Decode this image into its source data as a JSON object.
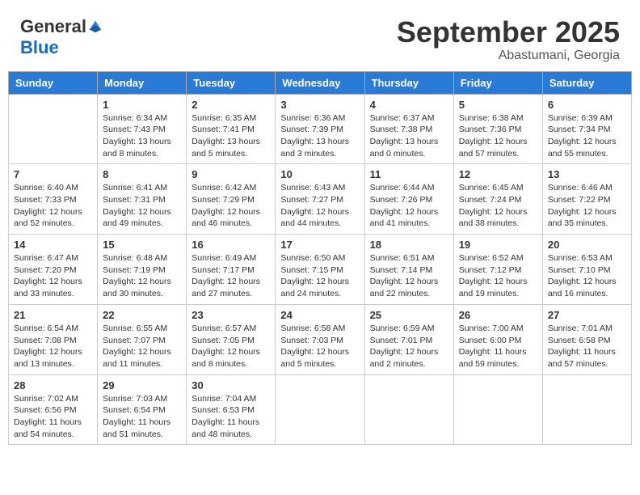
{
  "header": {
    "logo_general": "General",
    "logo_blue": "Blue",
    "month_title": "September 2025",
    "location": "Abastumani, Georgia"
  },
  "weekdays": [
    "Sunday",
    "Monday",
    "Tuesday",
    "Wednesday",
    "Thursday",
    "Friday",
    "Saturday"
  ],
  "weeks": [
    [
      {
        "day": "",
        "sunrise": "",
        "sunset": "",
        "daylight": ""
      },
      {
        "day": "1",
        "sunrise": "Sunrise: 6:34 AM",
        "sunset": "Sunset: 7:43 PM",
        "daylight": "Daylight: 13 hours and 8 minutes."
      },
      {
        "day": "2",
        "sunrise": "Sunrise: 6:35 AM",
        "sunset": "Sunset: 7:41 PM",
        "daylight": "Daylight: 13 hours and 5 minutes."
      },
      {
        "day": "3",
        "sunrise": "Sunrise: 6:36 AM",
        "sunset": "Sunset: 7:39 PM",
        "daylight": "Daylight: 13 hours and 3 minutes."
      },
      {
        "day": "4",
        "sunrise": "Sunrise: 6:37 AM",
        "sunset": "Sunset: 7:38 PM",
        "daylight": "Daylight: 13 hours and 0 minutes."
      },
      {
        "day": "5",
        "sunrise": "Sunrise: 6:38 AM",
        "sunset": "Sunset: 7:36 PM",
        "daylight": "Daylight: 12 hours and 57 minutes."
      },
      {
        "day": "6",
        "sunrise": "Sunrise: 6:39 AM",
        "sunset": "Sunset: 7:34 PM",
        "daylight": "Daylight: 12 hours and 55 minutes."
      }
    ],
    [
      {
        "day": "7",
        "sunrise": "Sunrise: 6:40 AM",
        "sunset": "Sunset: 7:33 PM",
        "daylight": "Daylight: 12 hours and 52 minutes."
      },
      {
        "day": "8",
        "sunrise": "Sunrise: 6:41 AM",
        "sunset": "Sunset: 7:31 PM",
        "daylight": "Daylight: 12 hours and 49 minutes."
      },
      {
        "day": "9",
        "sunrise": "Sunrise: 6:42 AM",
        "sunset": "Sunset: 7:29 PM",
        "daylight": "Daylight: 12 hours and 46 minutes."
      },
      {
        "day": "10",
        "sunrise": "Sunrise: 6:43 AM",
        "sunset": "Sunset: 7:27 PM",
        "daylight": "Daylight: 12 hours and 44 minutes."
      },
      {
        "day": "11",
        "sunrise": "Sunrise: 6:44 AM",
        "sunset": "Sunset: 7:26 PM",
        "daylight": "Daylight: 12 hours and 41 minutes."
      },
      {
        "day": "12",
        "sunrise": "Sunrise: 6:45 AM",
        "sunset": "Sunset: 7:24 PM",
        "daylight": "Daylight: 12 hours and 38 minutes."
      },
      {
        "day": "13",
        "sunrise": "Sunrise: 6:46 AM",
        "sunset": "Sunset: 7:22 PM",
        "daylight": "Daylight: 12 hours and 35 minutes."
      }
    ],
    [
      {
        "day": "14",
        "sunrise": "Sunrise: 6:47 AM",
        "sunset": "Sunset: 7:20 PM",
        "daylight": "Daylight: 12 hours and 33 minutes."
      },
      {
        "day": "15",
        "sunrise": "Sunrise: 6:48 AM",
        "sunset": "Sunset: 7:19 PM",
        "daylight": "Daylight: 12 hours and 30 minutes."
      },
      {
        "day": "16",
        "sunrise": "Sunrise: 6:49 AM",
        "sunset": "Sunset: 7:17 PM",
        "daylight": "Daylight: 12 hours and 27 minutes."
      },
      {
        "day": "17",
        "sunrise": "Sunrise: 6:50 AM",
        "sunset": "Sunset: 7:15 PM",
        "daylight": "Daylight: 12 hours and 24 minutes."
      },
      {
        "day": "18",
        "sunrise": "Sunrise: 6:51 AM",
        "sunset": "Sunset: 7:14 PM",
        "daylight": "Daylight: 12 hours and 22 minutes."
      },
      {
        "day": "19",
        "sunrise": "Sunrise: 6:52 AM",
        "sunset": "Sunset: 7:12 PM",
        "daylight": "Daylight: 12 hours and 19 minutes."
      },
      {
        "day": "20",
        "sunrise": "Sunrise: 6:53 AM",
        "sunset": "Sunset: 7:10 PM",
        "daylight": "Daylight: 12 hours and 16 minutes."
      }
    ],
    [
      {
        "day": "21",
        "sunrise": "Sunrise: 6:54 AM",
        "sunset": "Sunset: 7:08 PM",
        "daylight": "Daylight: 12 hours and 13 minutes."
      },
      {
        "day": "22",
        "sunrise": "Sunrise: 6:55 AM",
        "sunset": "Sunset: 7:07 PM",
        "daylight": "Daylight: 12 hours and 11 minutes."
      },
      {
        "day": "23",
        "sunrise": "Sunrise: 6:57 AM",
        "sunset": "Sunset: 7:05 PM",
        "daylight": "Daylight: 12 hours and 8 minutes."
      },
      {
        "day": "24",
        "sunrise": "Sunrise: 6:58 AM",
        "sunset": "Sunset: 7:03 PM",
        "daylight": "Daylight: 12 hours and 5 minutes."
      },
      {
        "day": "25",
        "sunrise": "Sunrise: 6:59 AM",
        "sunset": "Sunset: 7:01 PM",
        "daylight": "Daylight: 12 hours and 2 minutes."
      },
      {
        "day": "26",
        "sunrise": "Sunrise: 7:00 AM",
        "sunset": "Sunset: 6:00 PM",
        "daylight": "Daylight: 11 hours and 59 minutes."
      },
      {
        "day": "27",
        "sunrise": "Sunrise: 7:01 AM",
        "sunset": "Sunset: 6:58 PM",
        "daylight": "Daylight: 11 hours and 57 minutes."
      }
    ],
    [
      {
        "day": "28",
        "sunrise": "Sunrise: 7:02 AM",
        "sunset": "Sunset: 6:56 PM",
        "daylight": "Daylight: 11 hours and 54 minutes."
      },
      {
        "day": "29",
        "sunrise": "Sunrise: 7:03 AM",
        "sunset": "Sunset: 6:54 PM",
        "daylight": "Daylight: 11 hours and 51 minutes."
      },
      {
        "day": "30",
        "sunrise": "Sunrise: 7:04 AM",
        "sunset": "Sunset: 6:53 PM",
        "daylight": "Daylight: 11 hours and 48 minutes."
      },
      {
        "day": "",
        "sunrise": "",
        "sunset": "",
        "daylight": ""
      },
      {
        "day": "",
        "sunrise": "",
        "sunset": "",
        "daylight": ""
      },
      {
        "day": "",
        "sunrise": "",
        "sunset": "",
        "daylight": ""
      },
      {
        "day": "",
        "sunrise": "",
        "sunset": "",
        "daylight": ""
      }
    ]
  ]
}
